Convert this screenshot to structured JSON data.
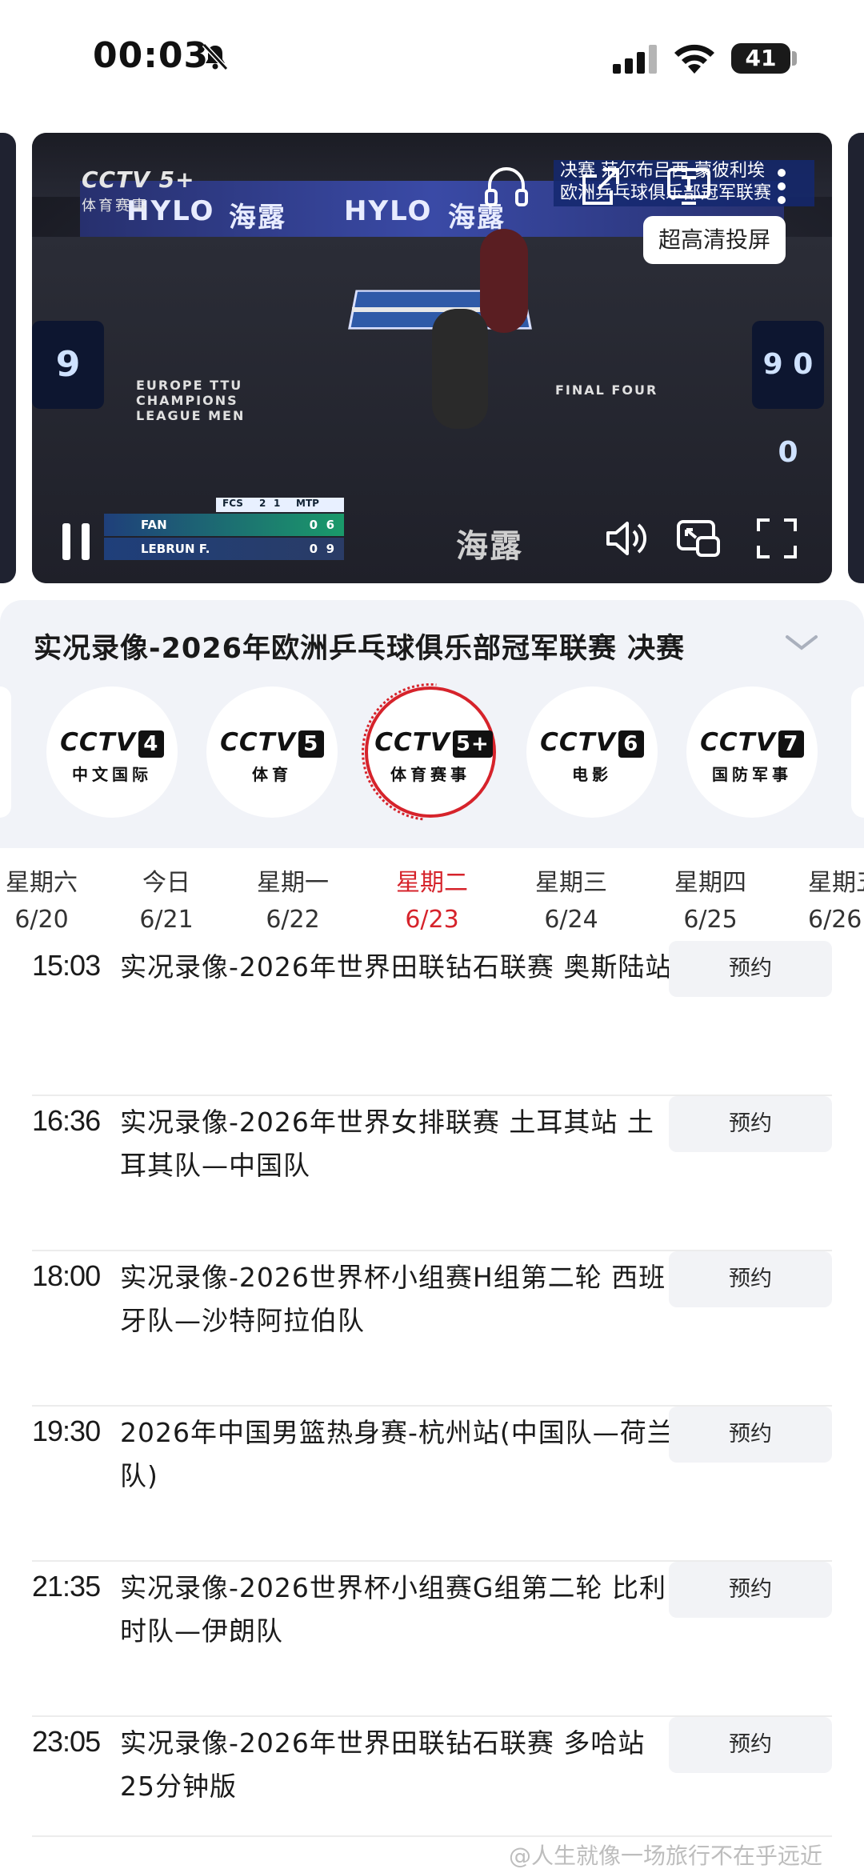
{
  "status_bar": {
    "time": "00:03",
    "battery": "41"
  },
  "player": {
    "channel_logo": "CCTV 5+",
    "channel_sub": "体育赛事",
    "ad_words": [
      "HYLO",
      "海露",
      "HYLO",
      "海露"
    ],
    "ticker_line1": "决赛 范尔布吕西 蒙彼利埃",
    "ticker_line2": "欧洲乒乓球俱乐部冠军联赛",
    "cast_tip": "超高清投屏",
    "floor_text_left": "EUROPE TTU CHAMPIONS LEAGUE MEN",
    "floor_text_right": "FINAL FOUR",
    "floor_ad": "海露",
    "scoreboard_left": "9",
    "scoreboard_right": "9 0 0",
    "scorebug": {
      "team1": "FCS",
      "sets1": "2",
      "sets2": "1",
      "team2": "MTP",
      "player1": "FAN",
      "score1": "0",
      "game1": "6",
      "player2": "LEBRUN F.",
      "score2": "0",
      "game2": "9"
    }
  },
  "panel": {
    "title": "实况录像-2026年欧洲乒乓球俱乐部冠军联赛 决赛",
    "channels": [
      {
        "logo": "CCTV",
        "num": "4",
        "sub": "中文国际",
        "active": false
      },
      {
        "logo": "CCTV",
        "num": "5",
        "sub": "体育",
        "active": false
      },
      {
        "logo": "CCTV",
        "num": "5+",
        "sub": "体育赛事",
        "active": true
      },
      {
        "logo": "CCTV",
        "num": "6",
        "sub": "电影",
        "active": false
      },
      {
        "logo": "CCTV",
        "num": "7",
        "sub": "国防军事",
        "active": false
      }
    ]
  },
  "dates": [
    {
      "weekday": "星期六",
      "date": "6/20",
      "selected": false
    },
    {
      "weekday": "今日",
      "date": "6/21",
      "selected": false
    },
    {
      "weekday": "星期一",
      "date": "6/22",
      "selected": false
    },
    {
      "weekday": "星期二",
      "date": "6/23",
      "selected": true
    },
    {
      "weekday": "星期三",
      "date": "6/24",
      "selected": false
    },
    {
      "weekday": "星期四",
      "date": "6/25",
      "selected": false
    },
    {
      "weekday": "星期五",
      "date": "6/26",
      "selected": false
    }
  ],
  "schedule": [
    {
      "time": "15:03",
      "title": "实况录像-2026年世界田联钻石联赛 奥斯陆站",
      "button": "预约"
    },
    {
      "time": "16:36",
      "title": "实况录像-2026年世界女排联赛 土耳其站 土耳其队—中国队",
      "button": "预约"
    },
    {
      "time": "18:00",
      "title": "实况录像-2026世界杯小组赛H组第二轮 西班牙队—沙特阿拉伯队",
      "button": "预约"
    },
    {
      "time": "19:30",
      "title": "2026年中国男篮热身赛-杭州站(中国队—荷兰队)",
      "button": "预约"
    },
    {
      "time": "21:35",
      "title": "实况录像-2026世界杯小组赛G组第二轮 比利时队—伊朗队",
      "button": "预约"
    },
    {
      "time": "23:05",
      "title": "实况录像-2026年世界田联钻石联赛 多哈站 25分钟版",
      "button": "预约"
    }
  ],
  "watermark": "@人生就像一场旅行不在乎远近",
  "colors": {
    "accent": "#d6232b",
    "panel_bg": "#f1f3f8",
    "button_bg": "#f2f3f6"
  }
}
